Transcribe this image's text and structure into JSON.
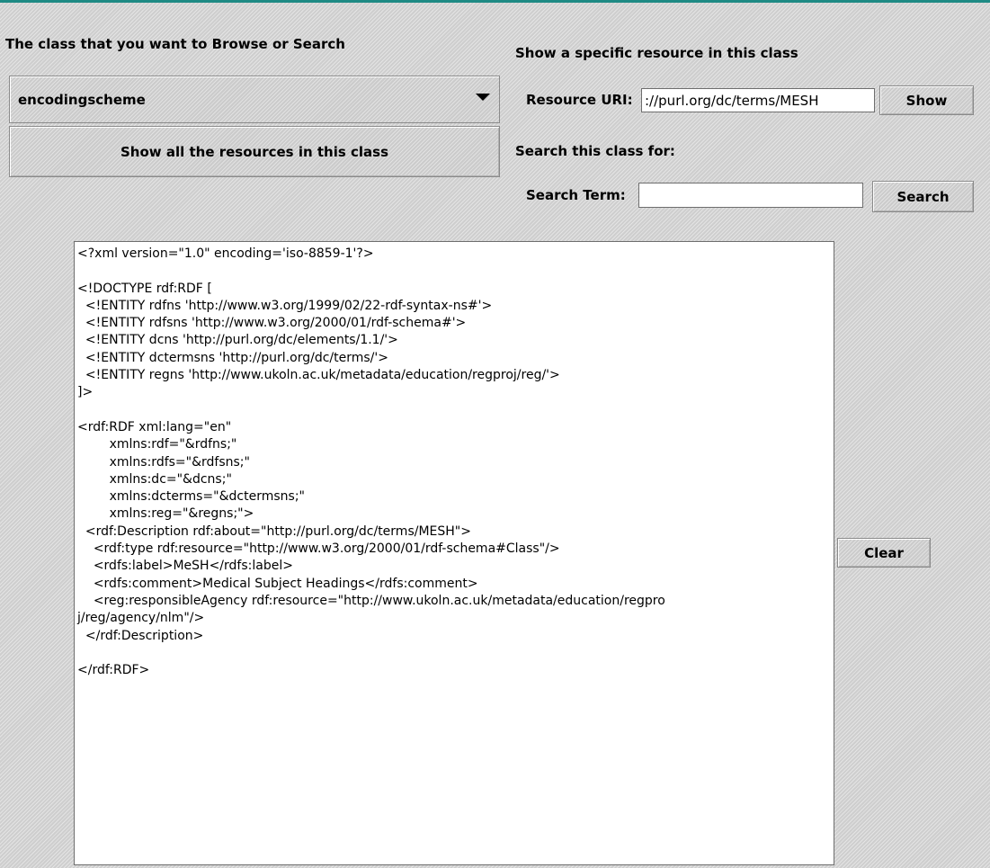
{
  "browse": {
    "class_label": "The class that you want to Browse or Search",
    "selected_class": "encodingscheme",
    "show_all_button": "Show all the resources in this class"
  },
  "resource": {
    "section_label": "Show a specific resource in this class",
    "uri_label": "Resource URI:",
    "uri_value": "://purl.org/dc/terms/MESH",
    "show_button": "Show"
  },
  "search": {
    "section_label": "Search this class for:",
    "term_label": "Search Term:",
    "term_value": "",
    "search_button": "Search"
  },
  "output": {
    "text": "<?xml version=\"1.0\" encoding='iso-8859-1'?>\n\n<!DOCTYPE rdf:RDF [\n  <!ENTITY rdfns 'http://www.w3.org/1999/02/22-rdf-syntax-ns#'>\n  <!ENTITY rdfsns 'http://www.w3.org/2000/01/rdf-schema#'>\n  <!ENTITY dcns 'http://purl.org/dc/elements/1.1/'>\n  <!ENTITY dctermsns 'http://purl.org/dc/terms/'>\n  <!ENTITY regns 'http://www.ukoln.ac.uk/metadata/education/regproj/reg/'>\n]>\n\n<rdf:RDF xml:lang=\"en\"\n        xmlns:rdf=\"&rdfns;\"\n        xmlns:rdfs=\"&rdfsns;\"\n        xmlns:dc=\"&dcns;\"\n        xmlns:dcterms=\"&dctermsns;\"\n        xmlns:reg=\"&regns;\">\n  <rdf:Description rdf:about=\"http://purl.org/dc/terms/MESH\">\n    <rdf:type rdf:resource=\"http://www.w3.org/2000/01/rdf-schema#Class\"/>\n    <rdfs:label>MeSH</rdfs:label>\n    <rdfs:comment>Medical Subject Headings</rdfs:comment>\n    <reg:responsibleAgency rdf:resource=\"http://www.ukoln.ac.uk/metadata/education/regpro\nj/reg/agency/nlm\"/>\n  </rdf:Description>\n\n</rdf:RDF>",
    "clear_button": "Clear"
  }
}
